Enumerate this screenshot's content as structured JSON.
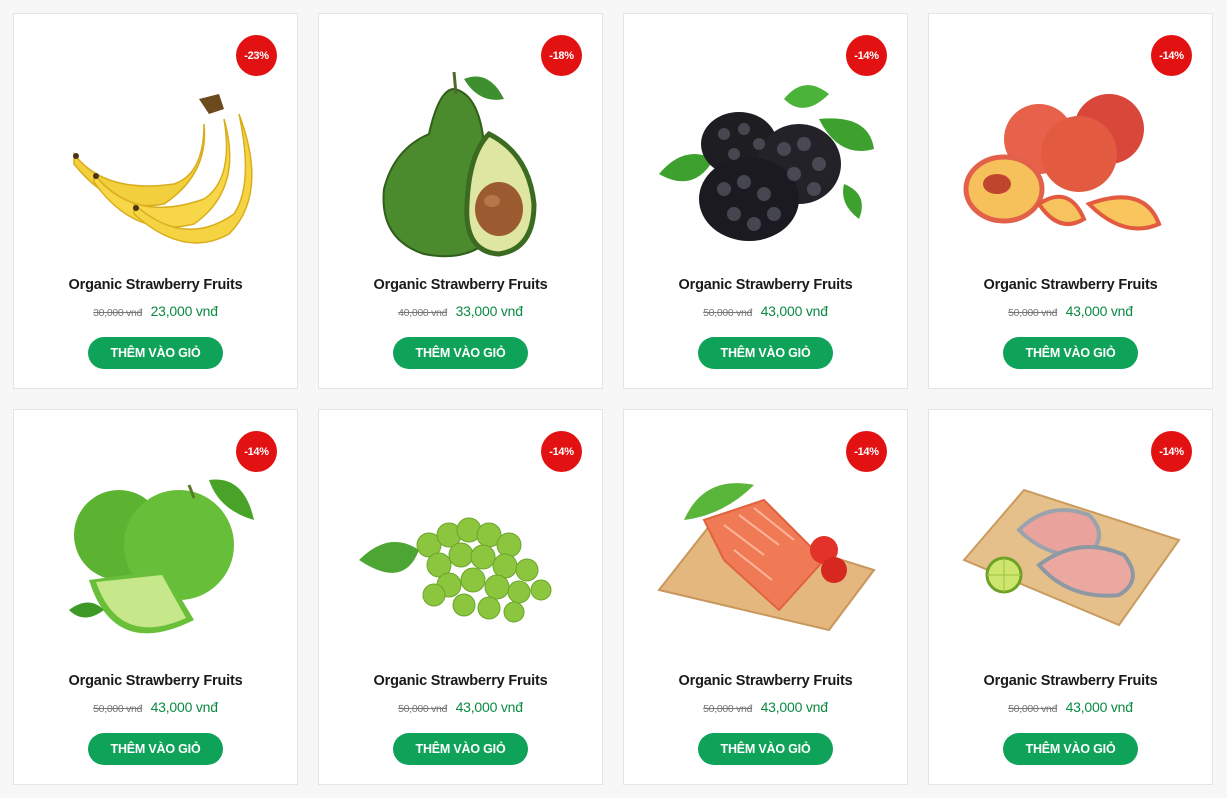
{
  "colors": {
    "badge": "#e31212",
    "button": "#0fa35a",
    "price": "#0a8a42"
  },
  "products": [
    {
      "title": "Organic Strawberry Fruits",
      "discount": "-23%",
      "old_price": "30,000 vnđ",
      "price": "23,000 vnđ",
      "button": "THÊM VÀO GIỎ",
      "image_icon": "banana-image"
    },
    {
      "title": "Organic Strawberry Fruits",
      "discount": "-18%",
      "old_price": "40,000 vnđ",
      "price": "33,000 vnđ",
      "button": "THÊM VÀO GIỎ",
      "image_icon": "avocado-image"
    },
    {
      "title": "Organic Strawberry Fruits",
      "discount": "-14%",
      "old_price": "50,000 vnđ",
      "price": "43,000 vnđ",
      "button": "THÊM VÀO GIỎ",
      "image_icon": "blackberry-image"
    },
    {
      "title": "Organic Strawberry Fruits",
      "discount": "-14%",
      "old_price": "50,000 vnđ",
      "price": "43,000 vnđ",
      "button": "THÊM VÀO GIỎ",
      "image_icon": "peach-image"
    },
    {
      "title": "Organic Strawberry Fruits",
      "discount": "-14%",
      "old_price": "50,000 vnđ",
      "price": "43,000 vnđ",
      "button": "THÊM VÀO GIỎ",
      "image_icon": "lime-image"
    },
    {
      "title": "Organic Strawberry Fruits",
      "discount": "-14%",
      "old_price": "50,000 vnđ",
      "price": "43,000 vnđ",
      "button": "THÊM VÀO GIỎ",
      "image_icon": "grapes-image"
    },
    {
      "title": "Organic Strawberry Fruits",
      "discount": "-14%",
      "old_price": "50,000 vnđ",
      "price": "43,000 vnđ",
      "button": "THÊM VÀO GIỎ",
      "image_icon": "salmon-image"
    },
    {
      "title": "Organic Strawberry Fruits",
      "discount": "-14%",
      "old_price": "50,000 vnđ",
      "price": "43,000 vnđ",
      "button": "THÊM VÀO GIỎ",
      "image_icon": "fish-image"
    }
  ]
}
